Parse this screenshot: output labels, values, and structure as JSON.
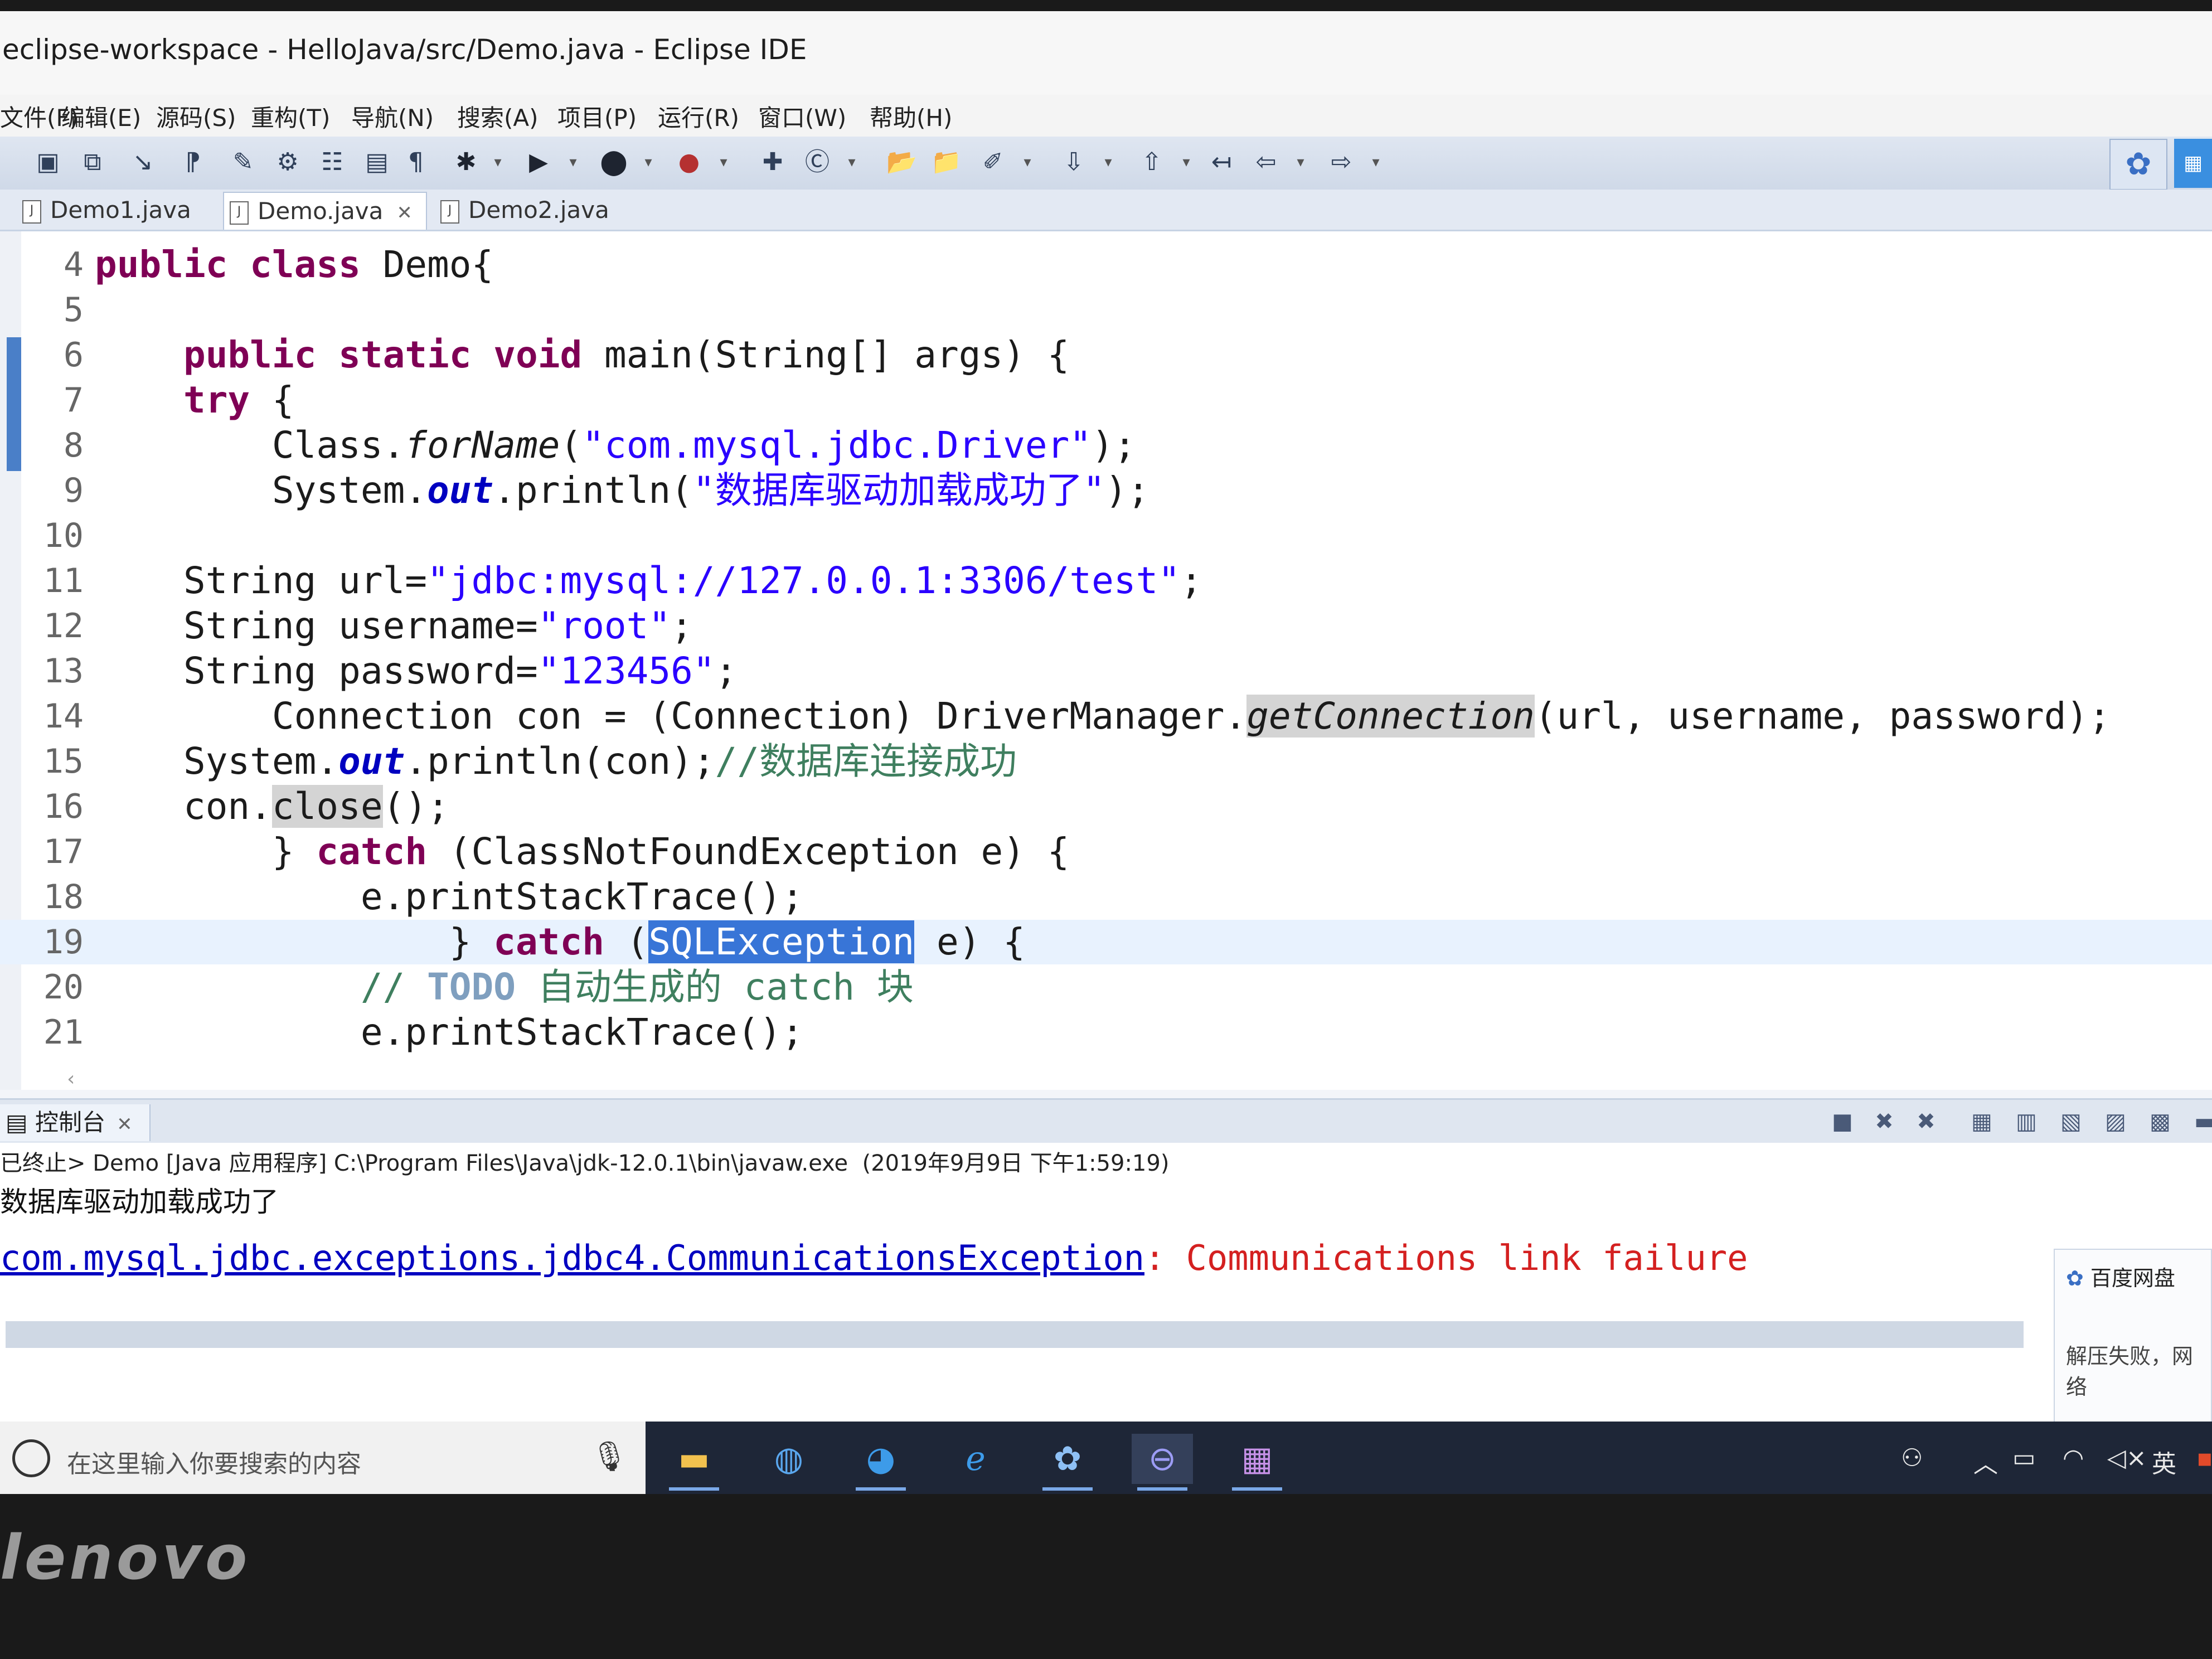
{
  "window": {
    "title": "eclipse-workspace - HelloJava/src/Demo.java - Eclipse IDE"
  },
  "menu": [
    "文件(F)",
    "编辑(E)",
    "源码(S)",
    "重构(T)",
    "导航(N)",
    "搜索(A)",
    "项目(P)",
    "运行(R)",
    "窗口(W)",
    "帮助(H)"
  ],
  "tabs": [
    {
      "label": "Demo1.java",
      "active": false
    },
    {
      "label": "Demo.java",
      "active": true
    },
    {
      "label": "Demo2.java",
      "active": false
    }
  ],
  "editor": {
    "lines": [
      {
        "num": "4",
        "indent": "",
        "tokens": [
          [
            "kw",
            "public "
          ],
          [
            "kw",
            "class "
          ],
          [
            "t",
            "Demo{"
          ]
        ]
      },
      {
        "num": "5",
        "indent": "",
        "tokens": []
      },
      {
        "num": "6",
        "indent": "    ",
        "tokens": [
          [
            "kw",
            "public "
          ],
          [
            "kw",
            "static "
          ],
          [
            "kw",
            "void "
          ],
          [
            "t",
            "main(String[] args) {"
          ]
        ]
      },
      {
        "num": "7",
        "indent": "    ",
        "tokens": [
          [
            "kw",
            "try "
          ],
          [
            "t",
            "{"
          ]
        ]
      },
      {
        "num": "8",
        "indent": "        ",
        "tokens": [
          [
            "t",
            "Class."
          ],
          [
            "ital",
            "forName"
          ],
          [
            "t",
            "("
          ],
          [
            "str",
            "\"com.mysql.jdbc.Driver\""
          ],
          [
            "t",
            ");"
          ]
        ]
      },
      {
        "num": "9",
        "indent": "        ",
        "tokens": [
          [
            "t",
            "System."
          ],
          [
            "fld",
            "out"
          ],
          [
            "t",
            ".println("
          ],
          [
            "str",
            "\"数据库驱动加载成功了\""
          ],
          [
            "t",
            ");"
          ]
        ]
      },
      {
        "num": "10",
        "indent": "",
        "tokens": []
      },
      {
        "num": "11",
        "indent": "    ",
        "tokens": [
          [
            "t",
            "String url="
          ],
          [
            "str",
            "\"jdbc:mysql://127.0.0.1:3306/test\""
          ],
          [
            "t",
            ";"
          ]
        ]
      },
      {
        "num": "12",
        "indent": "    ",
        "tokens": [
          [
            "t",
            "String username="
          ],
          [
            "str",
            "\"root\""
          ],
          [
            "t",
            ";"
          ]
        ]
      },
      {
        "num": "13",
        "indent": "    ",
        "tokens": [
          [
            "t",
            "String password="
          ],
          [
            "str",
            "\"123456\""
          ],
          [
            "t",
            ";"
          ]
        ]
      },
      {
        "num": "14",
        "indent": "        ",
        "tokens": [
          [
            "t",
            "Connection con = (Connection) DriverManager."
          ],
          [
            "occital",
            "getConnection"
          ],
          [
            "t",
            "(url, username, password);"
          ]
        ]
      },
      {
        "num": "15",
        "indent": "    ",
        "tokens": [
          [
            "t",
            "System."
          ],
          [
            "fld",
            "out"
          ],
          [
            "t",
            ".println(con);"
          ],
          [
            "cmt",
            "//数据库连接成功"
          ]
        ]
      },
      {
        "num": "16",
        "indent": "    ",
        "tokens": [
          [
            "t",
            "con."
          ],
          [
            "occ",
            "close"
          ],
          [
            "t",
            "();"
          ]
        ]
      },
      {
        "num": "17",
        "indent": "        ",
        "tokens": [
          [
            "t",
            "} "
          ],
          [
            "kw",
            "catch "
          ],
          [
            "t",
            "(ClassNotFoundException e) {"
          ]
        ]
      },
      {
        "num": "18",
        "indent": "            ",
        "tokens": [
          [
            "t",
            "e.printStackTrace();"
          ]
        ]
      },
      {
        "num": "19",
        "indent": "                ",
        "tokens": [
          [
            "t",
            "} "
          ],
          [
            "kw",
            "catch "
          ],
          [
            "t",
            "("
          ],
          [
            "sel",
            "SQLException"
          ],
          [
            "t",
            " e) {"
          ]
        ]
      },
      {
        "num": "20",
        "indent": "            ",
        "tokens": [
          [
            "cmt",
            "// "
          ],
          [
            "todo",
            "TODO "
          ],
          [
            "cmt",
            "自动生成的 catch 块"
          ]
        ]
      },
      {
        "num": "21",
        "indent": "            ",
        "tokens": [
          [
            "t",
            "e.printStackTrace();"
          ]
        ]
      }
    ],
    "highlight_line": "19"
  },
  "console": {
    "tab_label": "控制台",
    "launch_info": "已终止> Demo [Java 应用程序] C:\\Program Files\\Java\\jdk-12.0.1\\bin\\javaw.exe  (2019年9月9日 下午1:59:19)",
    "output_line": "数据库驱动加载成功了",
    "error_exception": "com.mysql.jdbc.exceptions.jdbc4.CommunicationsException",
    "error_separator": ": ",
    "error_message": "Communications link failure"
  },
  "notification": {
    "title": "百度网盘",
    "body": "解压失败，网络"
  },
  "taskbar": {
    "search_placeholder": "在这里输入你要搜索的内容",
    "apps": [
      "file-explorer-icon",
      "browser-360-icon",
      "quark-browser-icon",
      "edge-icon",
      "baidu-netdisk-icon",
      "eclipse-icon",
      "winrar-icon"
    ],
    "ime": "英"
  },
  "bezel_brand": "lenovo"
}
